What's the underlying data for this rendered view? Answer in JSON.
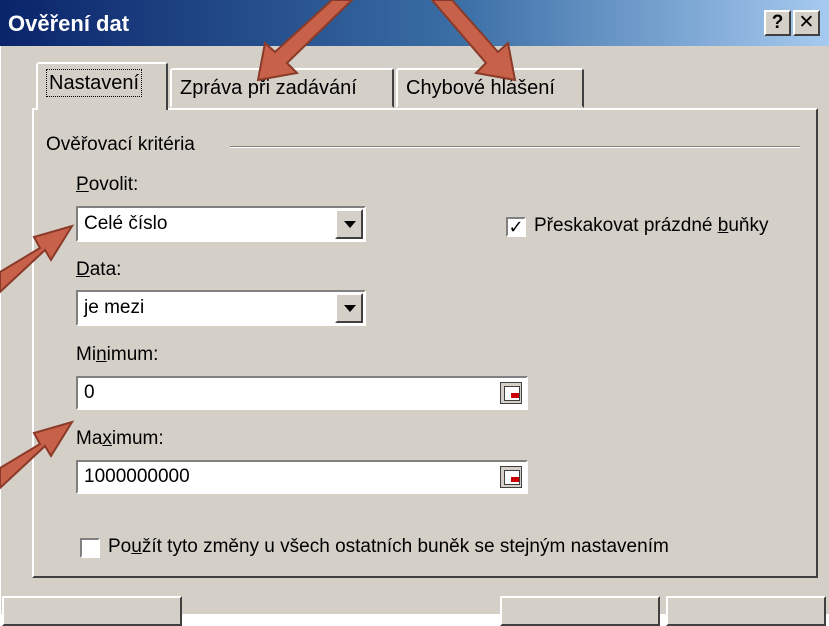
{
  "window": {
    "title": "Ověření dat",
    "help_label": "?",
    "close_label": "✕"
  },
  "tabs": [
    {
      "label": "Nastavení",
      "active": true
    },
    {
      "label": "Zpráva při zadávání",
      "active": false
    },
    {
      "label": "Chybové hlášení",
      "active": false
    }
  ],
  "group": {
    "label": "Ověřovací kritéria"
  },
  "povolit": {
    "label_pre": "",
    "label_u": "P",
    "label_post": "ovolit:",
    "value": "Celé číslo"
  },
  "data_field": {
    "label_pre": "",
    "label_u": "D",
    "label_post": "ata:",
    "value": "je mezi"
  },
  "minimum": {
    "label_pre": "Mi",
    "label_u": "n",
    "label_post": "imum:",
    "value": "0"
  },
  "maximum": {
    "label_pre": "Ma",
    "label_u": "x",
    "label_post": "imum:",
    "value": "1000000000"
  },
  "skip_blank": {
    "checked": true,
    "mark": "✓",
    "label_pre": "Přeskakovat prázdné ",
    "label_u": "b",
    "label_post": "uňky"
  },
  "apply_all": {
    "checked": false,
    "label_pre": "Po",
    "label_u": "u",
    "label_post": "žít tyto změny u všech ostatních buněk se stejným nastavením"
  },
  "colors": {
    "arrow": "#c8614a",
    "arrow_outline": "#8a3a28",
    "title_start": "#0a246a",
    "title_end": "#a6caf0",
    "face": "#d4d0c8"
  },
  "icons": {
    "dropdown": "chevron-down-icon",
    "range_select": "range-select-icon",
    "annotation": "arrow-annotation-icon"
  }
}
